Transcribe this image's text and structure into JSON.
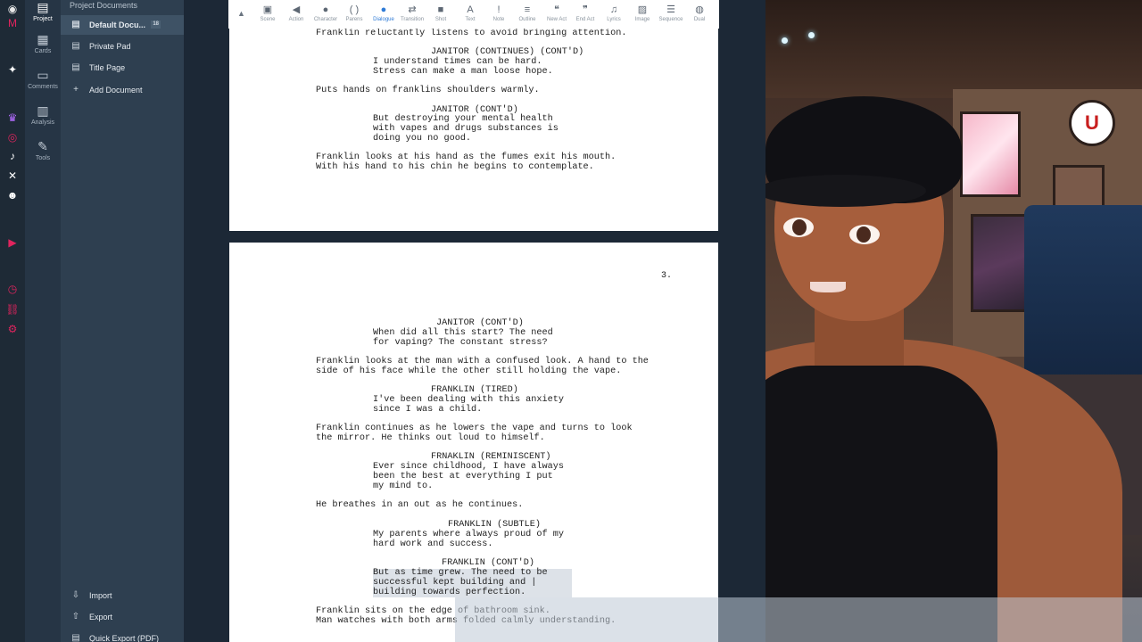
{
  "social": {
    "icons": [
      "patreon-icon",
      "ko-fi-icon",
      "vgen-icon",
      "throne-icon",
      "instagram-icon",
      "tiktok-icon",
      "x-icon",
      "discord-icon",
      "youtube-icon",
      "clock-icon",
      "link-icon",
      "settings-icon"
    ]
  },
  "rail": {
    "items": [
      {
        "label": "Project",
        "icon": "document-icon"
      },
      {
        "label": "Cards",
        "icon": "grid-icon"
      },
      {
        "label": "Comments",
        "icon": "comment-icon"
      },
      {
        "label": "Analysis",
        "icon": "bar-chart-icon"
      },
      {
        "label": "Tools",
        "icon": "wrench-icon"
      }
    ]
  },
  "sidebar": {
    "header": "Project Documents",
    "items": [
      {
        "label": "Default Docu...",
        "badge": "18"
      },
      {
        "label": "Private Pad"
      },
      {
        "label": "Title Page"
      },
      {
        "label": "Add Document"
      }
    ],
    "bottom": [
      {
        "label": "Import"
      },
      {
        "label": "Export"
      },
      {
        "label": "Quick Export (PDF)"
      }
    ]
  },
  "toolbar": {
    "buttons": [
      "Scene",
      "Action",
      "Character",
      "Parens",
      "Dialogue",
      "Transition",
      "Shot",
      "Text",
      "Note",
      "Outline",
      "New Act",
      "End Act",
      "Lyrics",
      "Image",
      "Sequence",
      "Dual"
    ],
    "active": "Dialogue"
  },
  "page1": {
    "lines": [
      "Franklin reluctantly listens to avoid bringing attention.",
      "JANITOR (CONTINUES) (CONT'D)",
      "I understand times can be hard.",
      "Stress can make a man loose hope.",
      "Puts hands on franklins shoulders warmly.",
      "JANITOR (CONT'D)",
      "But destroying your mental health",
      "with vapes and drugs substances is",
      "doing you no good.",
      "Franklin looks at his hand as the fumes exit his mouth.",
      "With his hand to his chin he begins to contemplate."
    ]
  },
  "page2": {
    "page_number": "3.",
    "lines": [
      "JANITOR (CONT'D)",
      "When did all this start? The need",
      "for vaping? The constant stress?",
      "Franklin looks at the man with a confused look. A hand to the",
      "side of his face while the other still holding the vape.",
      "FRANKLIN (TIRED)",
      "I've been dealing with this anxiety",
      "since I was a child.",
      "Franklin continues as he lowers the vape and turns to look",
      "the mirror. He thinks out loud to himself.",
      "FRNAKLIN (REMINISCENT)",
      "Ever since childhood, I have always",
      "been the best at everything I put",
      "my mind to.",
      "He breathes in an out as he continues.",
      "FRANKLIN (SUBTLE)",
      "My parents where always proud of my",
      "hard work and success.",
      "FRANKLIN (CONT'D)",
      "But as time grew. The need to be",
      "successful kept building and |",
      "building towards perfection.",
      "Franklin sits on the edge of bathroom sink.",
      "Man watches with both arms folded calmly understanding."
    ]
  },
  "colors": {
    "sidebar_bg": "#2e3f50",
    "rail_bg": "#263545",
    "editor_bg": "#1c2836",
    "accent": "#2f7bd6"
  }
}
